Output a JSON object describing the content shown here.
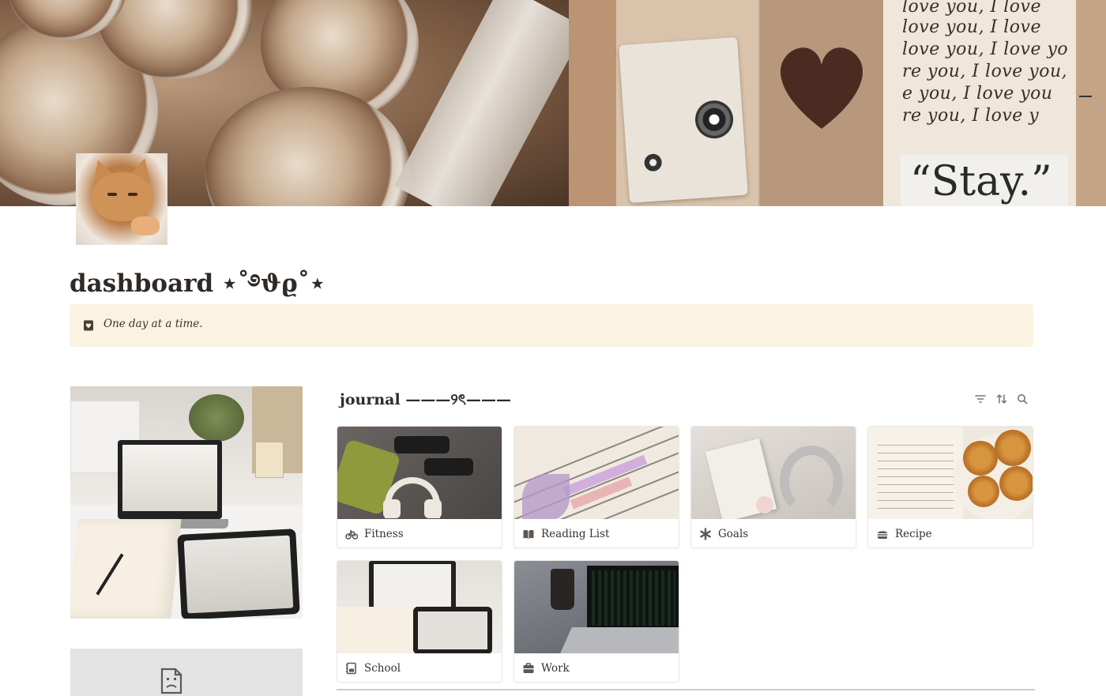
{
  "page": {
    "title": "dashboard ⋆˚࿔ϑϱ˚⋆",
    "callout_text": "One day at a time."
  },
  "cover": {
    "stay_text": "“Stay.”",
    "letters": [
      "love you, I love",
      "love you, I love",
      "love you, I love yo",
      "re you, I love you,",
      "e you, I love you",
      "re you, I love y"
    ]
  },
  "icons": {
    "callout": "heart-book-icon",
    "filter": "filter-icon",
    "sort": "sort-icon",
    "search": "search-icon",
    "broken_embed": "broken-file-icon"
  },
  "gallery": {
    "title": "journal ———୨ৎ———",
    "cards": [
      {
        "label": "Fitness",
        "icon": "bicycle-icon"
      },
      {
        "label": "Reading List",
        "icon": "open-book-icon"
      },
      {
        "label": "Goals",
        "icon": "asterisk-icon"
      },
      {
        "label": "Recipe",
        "icon": "burger-icon"
      },
      {
        "label": "School",
        "icon": "notebook-icon"
      },
      {
        "label": "Work",
        "icon": "briefcase-icon"
      }
    ]
  },
  "colors": {
    "callout_bg": "#fbf3e1",
    "text": "#2f2a26",
    "icon": "#6b625b"
  }
}
